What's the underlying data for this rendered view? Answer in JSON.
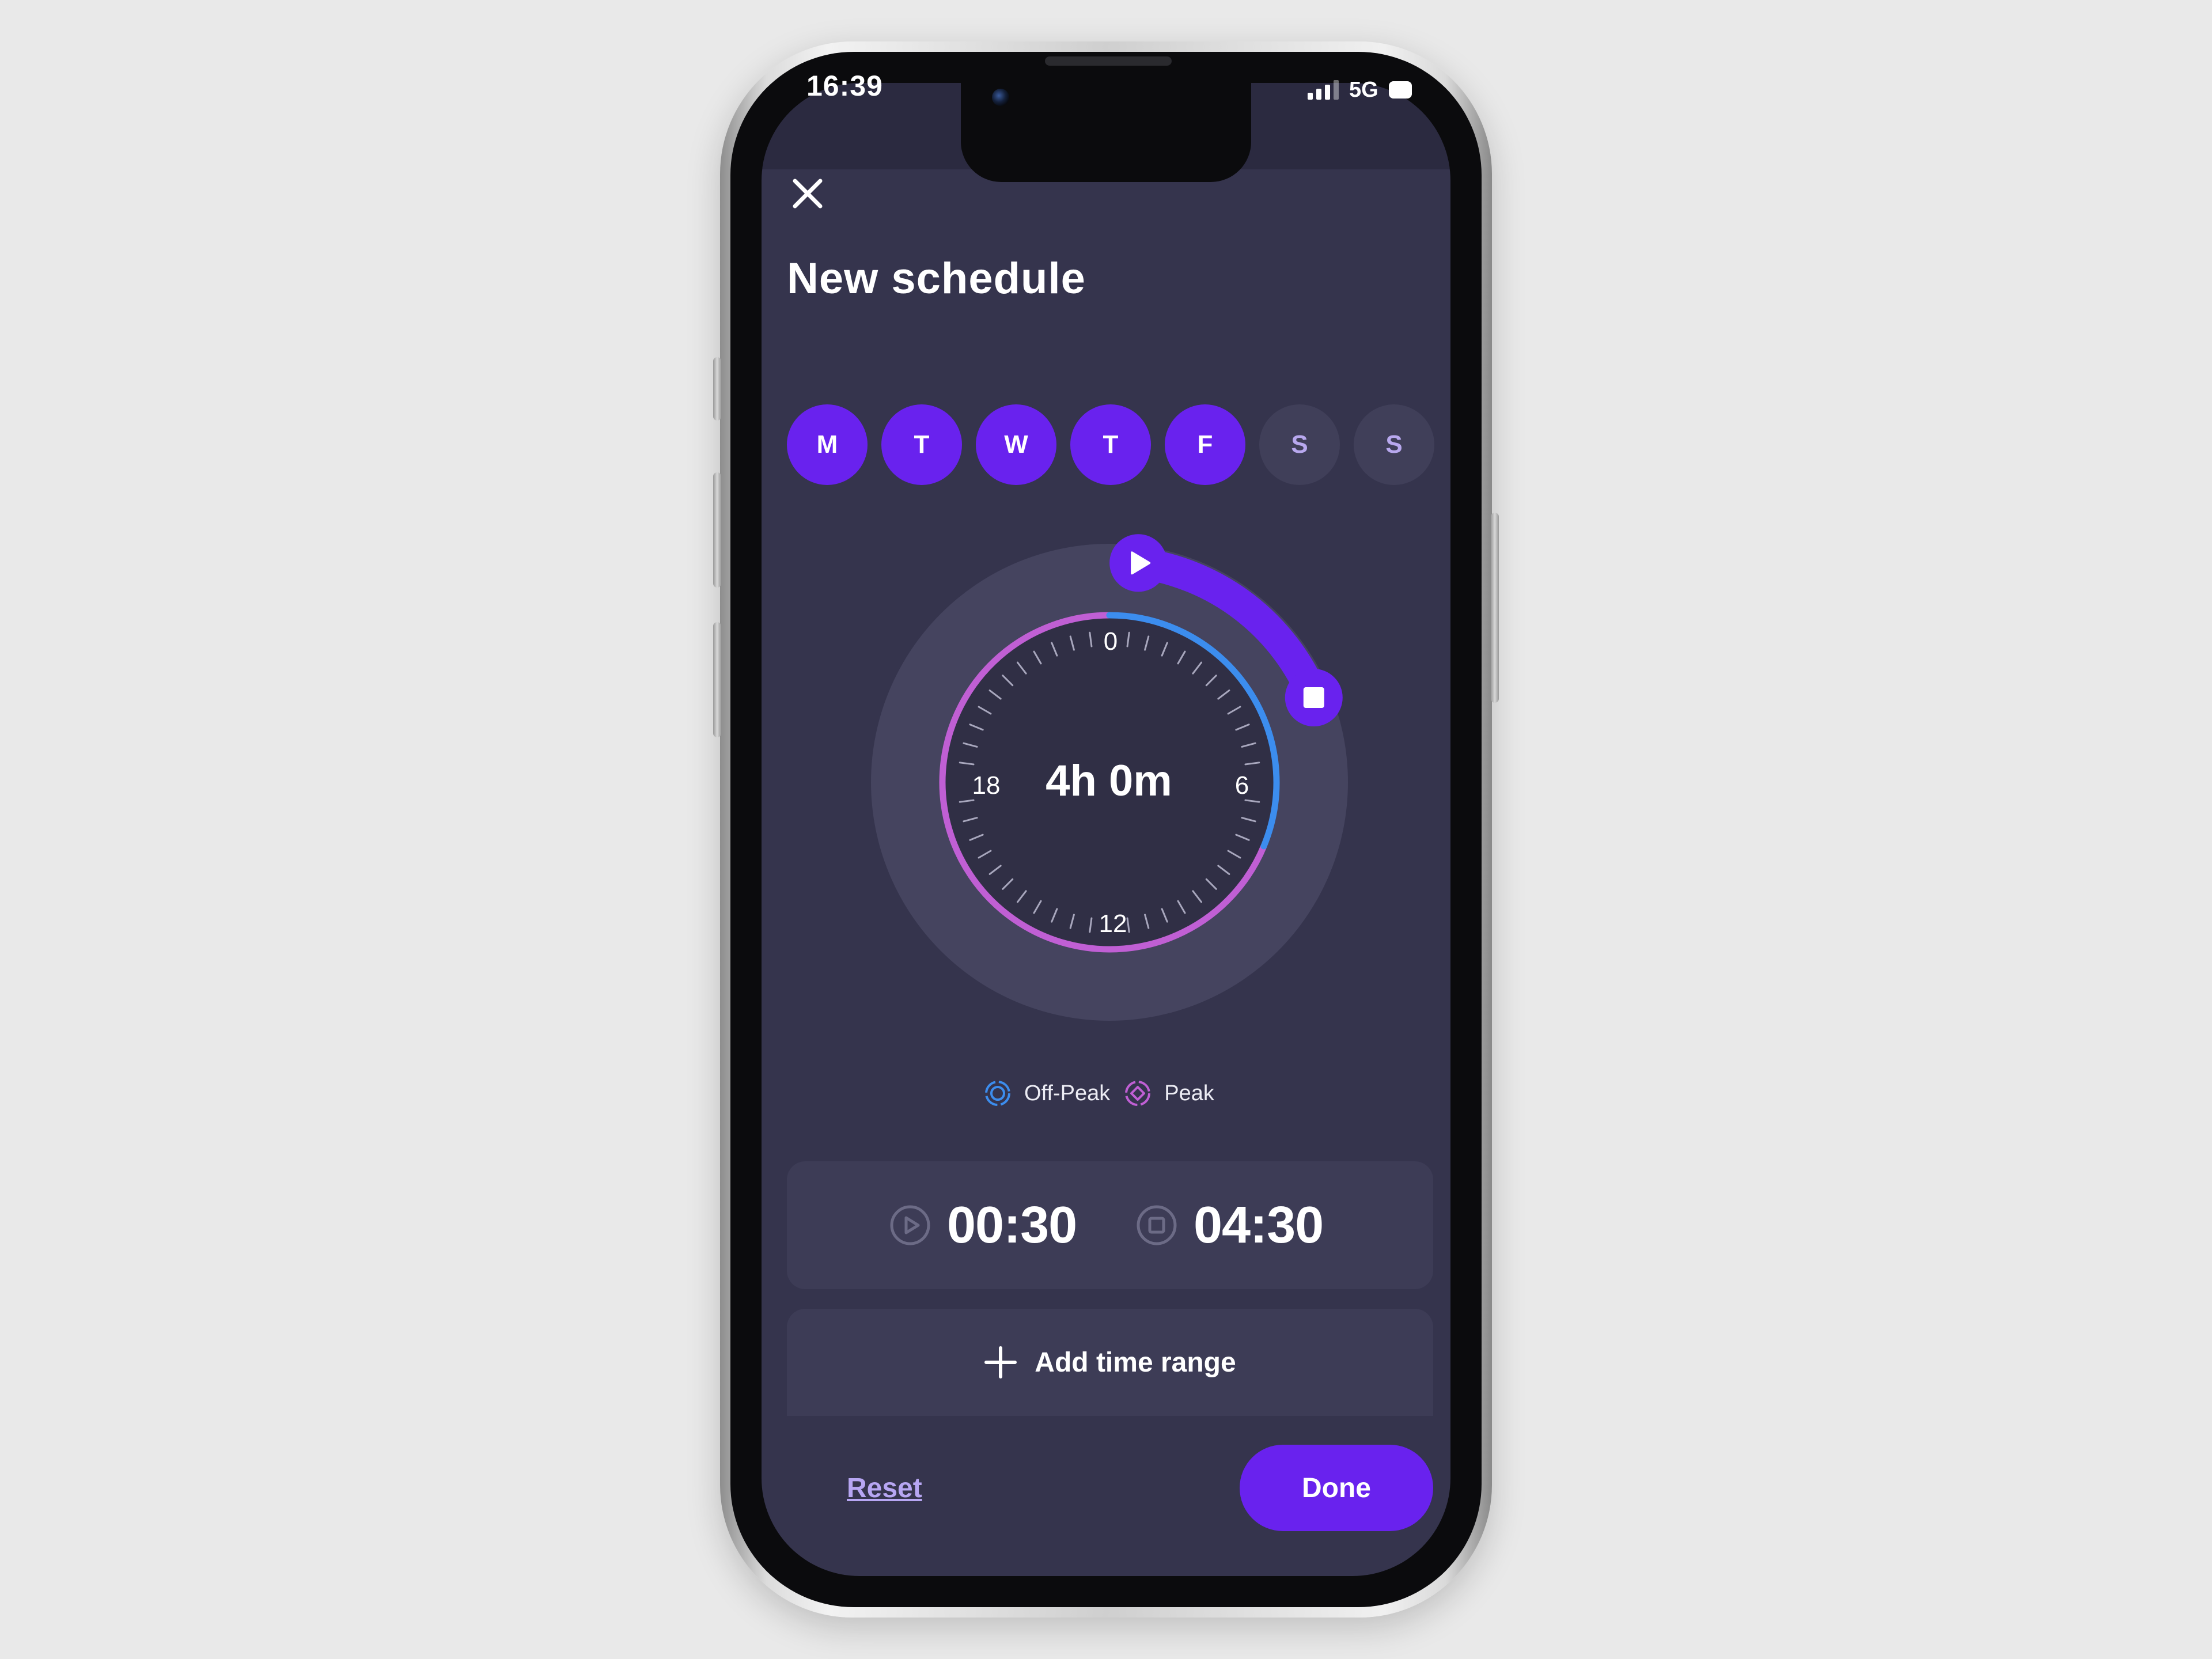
{
  "status_bar": {
    "time": "16:39",
    "network": "5G"
  },
  "header": {
    "title": "New schedule"
  },
  "days": [
    {
      "label": "M",
      "selected": true
    },
    {
      "label": "T",
      "selected": true
    },
    {
      "label": "W",
      "selected": true
    },
    {
      "label": "T",
      "selected": true
    },
    {
      "label": "F",
      "selected": true
    },
    {
      "label": "S",
      "selected": false
    },
    {
      "label": "S",
      "selected": false
    }
  ],
  "dial": {
    "duration": "4h 0m",
    "hour_labels": [
      "0",
      "6",
      "12",
      "18"
    ],
    "schedule_start_hour": 0.5,
    "schedule_end_hour": 4.5,
    "offpeak_start_hour": 0,
    "offpeak_end_hour": 7.5
  },
  "legend": {
    "offpeak_label": "Off-Peak",
    "peak_label": "Peak"
  },
  "times": {
    "start": "00:30",
    "end": "04:30"
  },
  "actions": {
    "add_range_label": "Add time range",
    "reset_label": "Reset",
    "done_label": "Done"
  },
  "colors": {
    "accent": "#6922ee",
    "offpeak": "#3c8dee",
    "peak": "#c05fd4",
    "background": "#35344d",
    "card": "#3d3c56"
  },
  "icons": {
    "close": "close-icon",
    "start": "play-icon",
    "end": "stop-icon",
    "add": "plus-icon",
    "offpeak": "offpeak-icon",
    "peak": "peak-icon"
  }
}
